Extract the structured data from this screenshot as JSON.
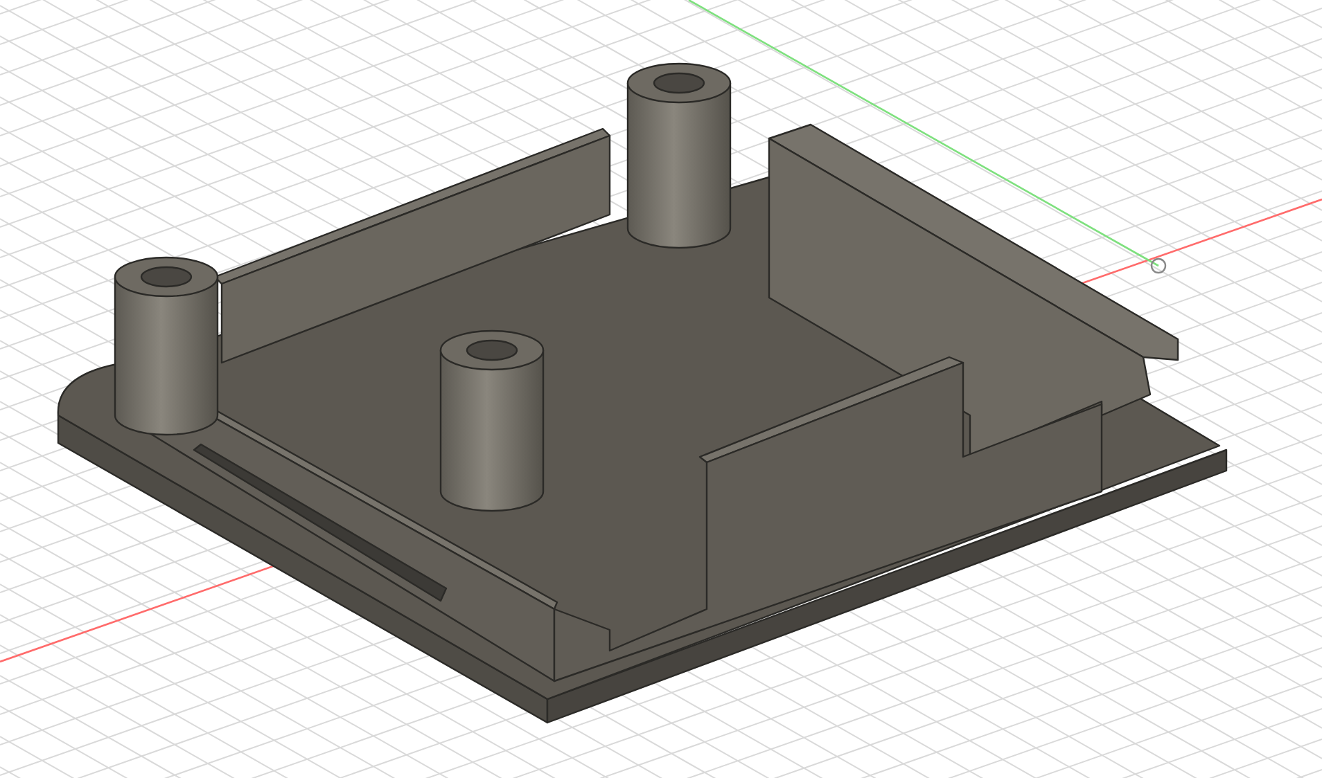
{
  "viewport": {
    "axes": [
      {
        "kind": "x",
        "color": "#ff6b6b"
      },
      {
        "kind": "y",
        "color": "#7ee07e"
      }
    ]
  }
}
